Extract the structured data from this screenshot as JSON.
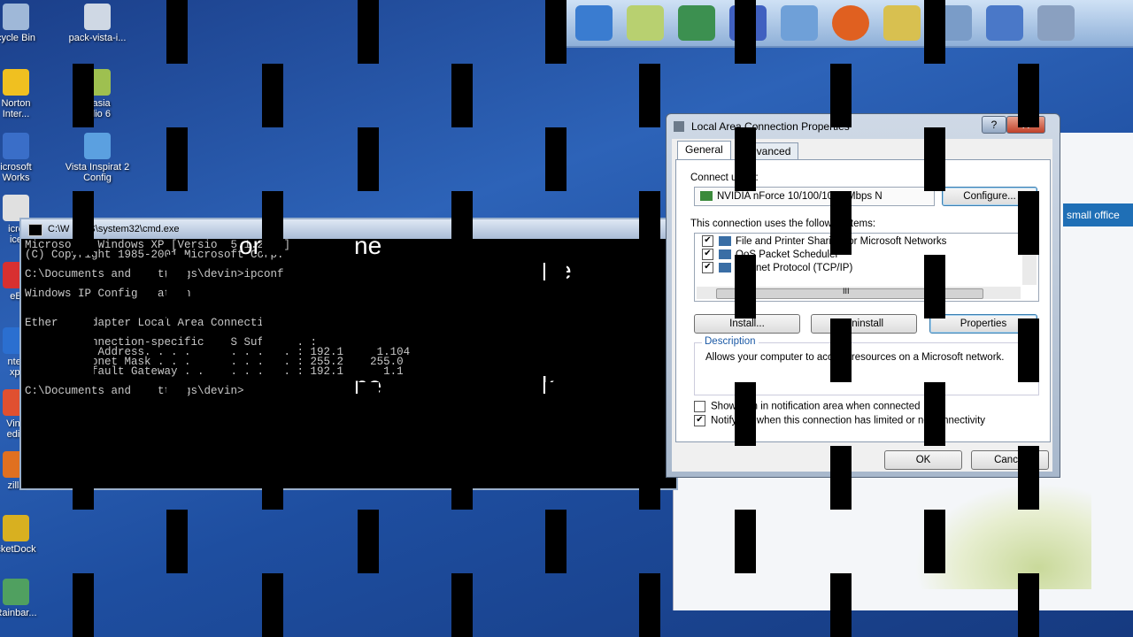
{
  "desktop": {
    "icons": [
      {
        "label": "cycle Bin",
        "color": "#9fb8d8"
      },
      {
        "label": "pack-vista-i...",
        "color": "#cfd8e4"
      },
      {
        "label": "Norton\nInter...",
        "color": "#f0c020"
      },
      {
        "label": "ntasia\nudio 6",
        "color": "#9ec050"
      },
      {
        "label": "icrosoft\nWorks",
        "color": "#3a6ec8"
      },
      {
        "label": "Vista Inspirat 2\nConfig",
        "color": "#5ba0e0"
      },
      {
        "label": "icro\nice",
        "color": "#e0e0e0"
      },
      {
        "label": "eB",
        "color": "#d83030"
      },
      {
        "label": "nter\nxpl",
        "color": "#2b6fd0"
      },
      {
        "label": "Vind\nedia",
        "color": "#e05030"
      },
      {
        "label": "zilla",
        "color": "#e07020"
      },
      {
        "label": "cketDock",
        "color": "#d8b020"
      },
      {
        "label": "Rainbar...",
        "color": "#50a060"
      }
    ]
  },
  "dock": {
    "items": [
      "monitor-icon",
      "document-icon",
      "display-icon",
      "computer-icon",
      "folder-icon",
      "firefox-icon",
      "library-icon",
      "pictures-icon",
      "network-icon",
      "gear-icon"
    ]
  },
  "cmd": {
    "title": "C:\\W     OWS\\system32\\cmd.exe",
    "lines": [
      "Microso  t Windows XP [Versio  5.1.2600]",
      "(C) Copyright 1985-2001 Microsoft Corp.",
      "",
      "C:\\Documents and    ttings\\devin>ipconf",
      "",
      "Windows IP Config   ation",
      "",
      "",
      "Ether    adapter Local Area Connection:",
      "",
      "        Connection-specific    S Suffix  . :",
      "        IP Address. . . .      . . . . . : 192.1     1.104",
      "        Subnet Mask . . .      . . . . . : 255.2    255.0",
      "        Default Gateway . .    . . . . . : 192.1      1.1",
      "",
      "C:\\Documents and    ttings\\devin>"
    ]
  },
  "overlay_words": [
    "o",
    "or",
    "ne",
    "c",
    "l",
    "e",
    "t",
    "ne",
    "k",
    "w",
    "c"
  ],
  "background_window": {
    "banner": "small office"
  },
  "dialog": {
    "title": "Local Area Connection Properties",
    "help_label": "?",
    "close_label": "X",
    "tabs": [
      "General",
      "Advanced"
    ],
    "connect_using_label": "Connect using:",
    "adapter_name": "NVIDIA nForce 10/100/1000 Mbps N",
    "configure_label": "Configure...",
    "items_label": "This connection uses the following items:",
    "items": [
      {
        "label": "File and Printer Sharing for Microsoft Networks",
        "checked": true
      },
      {
        "label": "QoS Packet Scheduler",
        "checked": true
      },
      {
        "label": "Internet Protocol (TCP/IP)",
        "checked": true
      }
    ],
    "scroll_grip": "III",
    "install_label": "Install...",
    "uninstall_label": "Uninstall",
    "properties_label": "Properties",
    "description_title": "Description",
    "description_text": "Allows your computer to access resources on a Microsoft network.",
    "show_icon_label": "Show icon in notification area when connected",
    "show_icon_checked": false,
    "notify_label": "Notify me when this connection has limited or no connectivity",
    "notify_checked": true,
    "ok_label": "OK",
    "cancel_label": "Cancel"
  }
}
